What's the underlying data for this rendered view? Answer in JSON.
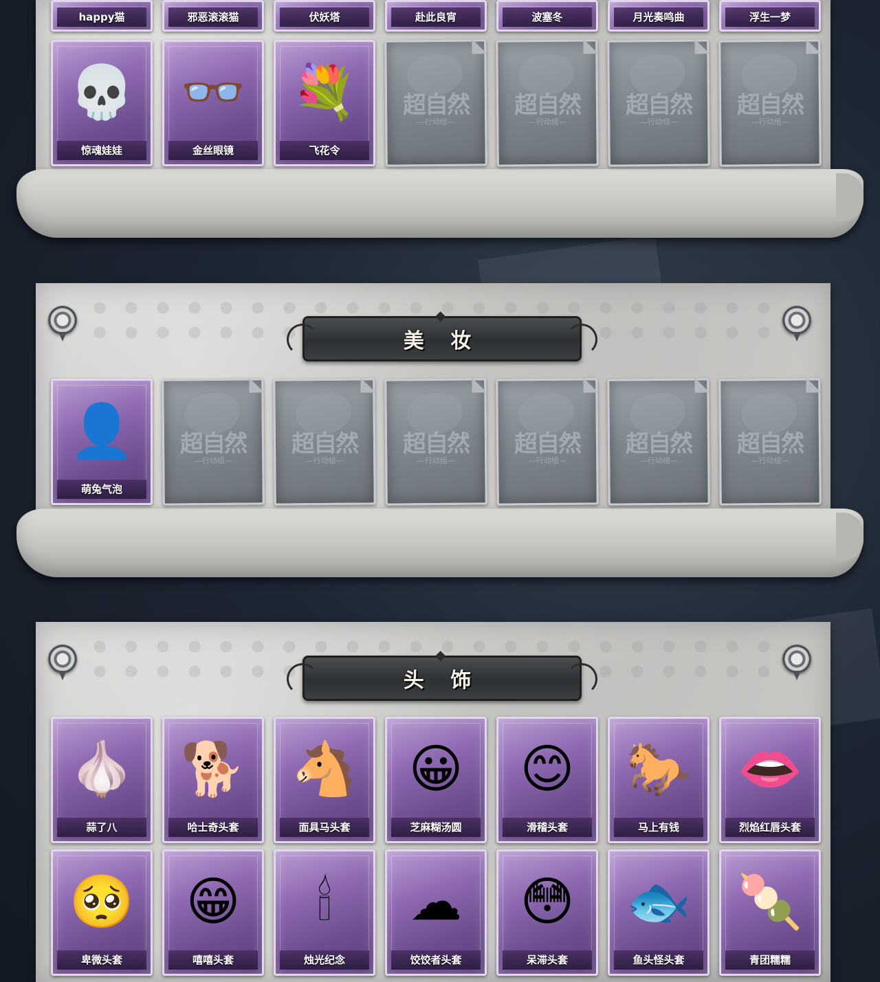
{
  "sections": {
    "accessories": {
      "top_row": [
        "happy猫",
        "邪恶滚滚猫",
        "伏妖塔",
        "赴此良宵",
        "波塞冬",
        "月光奏鸣曲",
        "浮生一梦"
      ],
      "second_row_owned": [
        {
          "name": "惊魂娃娃",
          "icon": "skull-mask-icon",
          "glyph": "💀"
        },
        {
          "name": "金丝眼镜",
          "icon": "glasses-icon",
          "glyph": "👓"
        },
        {
          "name": "飞花令",
          "icon": "flower-lantern-icon",
          "glyph": "💐"
        }
      ],
      "second_row_locked_count": 4
    },
    "makeup": {
      "title": "美 妆",
      "owned": [
        {
          "name": "萌兔气泡",
          "icon": "bunny-bubble-icon",
          "glyph": "👤"
        }
      ],
      "locked_count": 6
    },
    "headwear": {
      "title": "头 饰",
      "row1": [
        {
          "name": "蒜了八",
          "icon": "garlic-head-icon",
          "glyph": "🧄"
        },
        {
          "name": "哈士奇头套",
          "icon": "husky-head-icon",
          "glyph": "🐕"
        },
        {
          "name": "面具马头套",
          "icon": "horse-head-icon",
          "glyph": "🐴"
        },
        {
          "name": "芝麻糊汤圆",
          "icon": "dumpling-head-icon",
          "glyph": "😀"
        },
        {
          "name": "滑稽头套",
          "icon": "funny-face-icon",
          "glyph": "😊"
        },
        {
          "name": "马上有钱",
          "icon": "red-horse-icon",
          "glyph": "🐎"
        },
        {
          "name": "烈焰红唇头套",
          "icon": "pikachu-lips-icon",
          "glyph": "👄"
        }
      ],
      "row2": [
        {
          "name": "卑微头套",
          "icon": "humble-face-icon",
          "glyph": "🥺"
        },
        {
          "name": "嘻嘻头套",
          "icon": "grin-face-icon",
          "glyph": "😁"
        },
        {
          "name": "烛光纪念",
          "icon": "candle-head-icon",
          "glyph": "🕯"
        },
        {
          "name": "饺饺者头套",
          "icon": "cloud-face-icon",
          "glyph": "☁"
        },
        {
          "name": "呆滞头套",
          "icon": "stare-face-icon",
          "glyph": "😳"
        },
        {
          "name": "鱼头怪头套",
          "icon": "fish-head-icon",
          "glyph": "🐟"
        },
        {
          "name": "青团糯糯",
          "icon": "green-rice-ball-icon",
          "glyph": "🍡"
        }
      ]
    }
  },
  "locked_watermark": {
    "main": "超自然",
    "sub": "—行动组—"
  },
  "colors": {
    "owned_card": "#8e6ab1",
    "locked_card": "#7f868d",
    "banner": "#2e3133"
  }
}
